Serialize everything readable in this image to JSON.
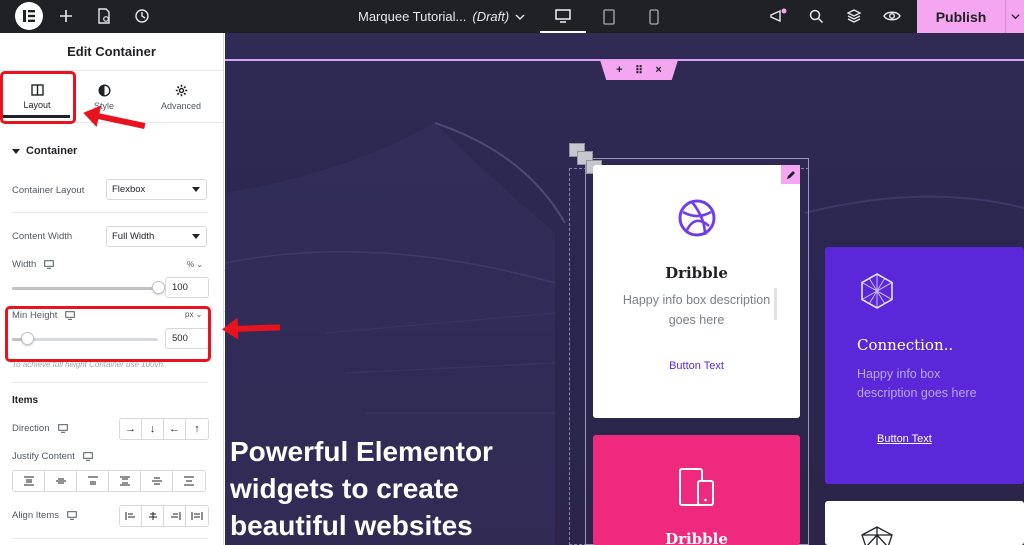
{
  "topbar": {
    "doc_name": "Marquee Tutorial...",
    "doc_status": "(Draft)",
    "publish_label": "Publish",
    "active_device": "desktop"
  },
  "panel": {
    "title": "Edit Container",
    "tabs": [
      {
        "label": "Layout",
        "icon": "layout-columns-icon",
        "active": true
      },
      {
        "label": "Style",
        "icon": "half-circle-icon",
        "active": false
      },
      {
        "label": "Advanced",
        "icon": "gear-icon",
        "active": false
      }
    ],
    "section_container": "Container",
    "container_layout": {
      "label": "Container Layout",
      "value": "Flexbox"
    },
    "content_width": {
      "label": "Content Width",
      "value": "Full Width"
    },
    "width": {
      "label": "Width",
      "unit": "%",
      "value": "100",
      "level": 1.0
    },
    "min_height": {
      "label": "Min Height",
      "unit": "px",
      "value": "500",
      "level": 0.1
    },
    "min_height_hint": "To achieve full height Container use 100vh.",
    "section_items": "Items",
    "direction": {
      "label": "Direction",
      "options": [
        "→",
        "↓",
        "←",
        "↑"
      ]
    },
    "justify_content": {
      "label": "Justify Content",
      "icons": [
        "justify-start-icon",
        "justify-center-icon",
        "justify-end-icon",
        "justify-space-between-icon",
        "justify-space-around-icon",
        "justify-space-evenly-icon"
      ]
    },
    "align_items": {
      "label": "Align Items",
      "icons": [
        "align-start-icon",
        "align-center-icon",
        "align-end-icon",
        "align-stretch-icon"
      ]
    }
  },
  "canvas": {
    "hero_lines": [
      "Powerful Elementor",
      "widgets to create",
      "beautiful websites"
    ],
    "cards": [
      {
        "title": "Dribble",
        "desc_lines": [
          "Happy info box description",
          "goes here"
        ],
        "button": "Button Text"
      },
      {
        "title": "Connection..",
        "desc_lines": [
          "Happy info box",
          "description goes here"
        ],
        "button": "Button Text"
      },
      {
        "title": "Dribble"
      }
    ]
  },
  "colors": {
    "accent": "#f5a6f0",
    "annotation_red": "#e8131e",
    "card_purple": "#5a28d8",
    "card_pink": "#ef2a7e",
    "canvas_bg": "#2c2850"
  }
}
